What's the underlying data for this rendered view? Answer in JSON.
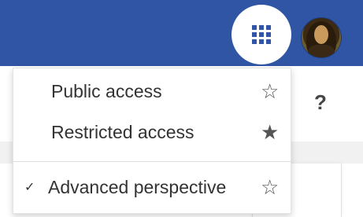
{
  "header": {
    "apps_icon": "grid-9-icon",
    "avatar": "mona-lisa-avatar",
    "brand_color": "#2f55a4"
  },
  "help": {
    "label": "?"
  },
  "menu": {
    "items": [
      {
        "label": "Public access",
        "checked": "",
        "star": "☆",
        "starred": false
      },
      {
        "label": "Restricted access",
        "checked": "",
        "star": "★",
        "starred": true
      },
      {
        "label": "Advanced perspective",
        "checked": "✓",
        "star": "☆",
        "starred": false
      }
    ]
  }
}
